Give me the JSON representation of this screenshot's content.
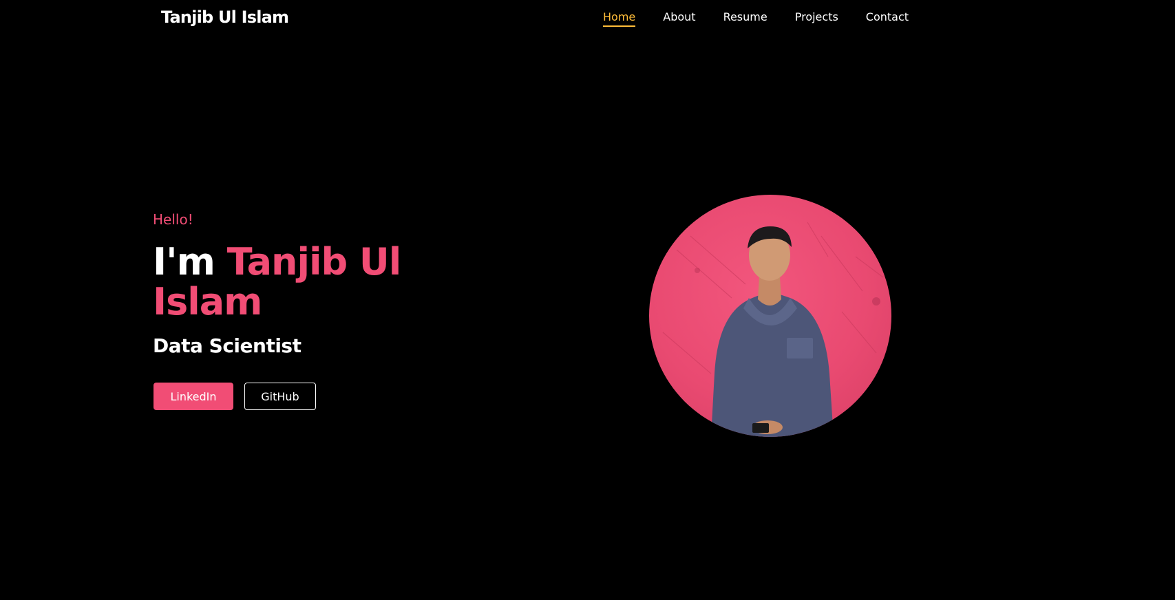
{
  "brand": "Tanjib Ul Islam",
  "nav": {
    "items": [
      {
        "label": "Home",
        "active": true
      },
      {
        "label": "About",
        "active": false
      },
      {
        "label": "Resume",
        "active": false
      },
      {
        "label": "Projects",
        "active": false
      },
      {
        "label": "Contact",
        "active": false
      }
    ]
  },
  "hero": {
    "greeting": "Hello!",
    "headline_prefix": "I'm ",
    "headline_name": "Tanjib Ul Islam",
    "role": "Data Scientist",
    "buttons": {
      "primary_label": "LinkedIn",
      "secondary_label": "GitHub"
    }
  },
  "colors": {
    "background": "#000000",
    "accent": "#f14d75",
    "nav_active": "#ffbd39",
    "text": "#ffffff"
  }
}
